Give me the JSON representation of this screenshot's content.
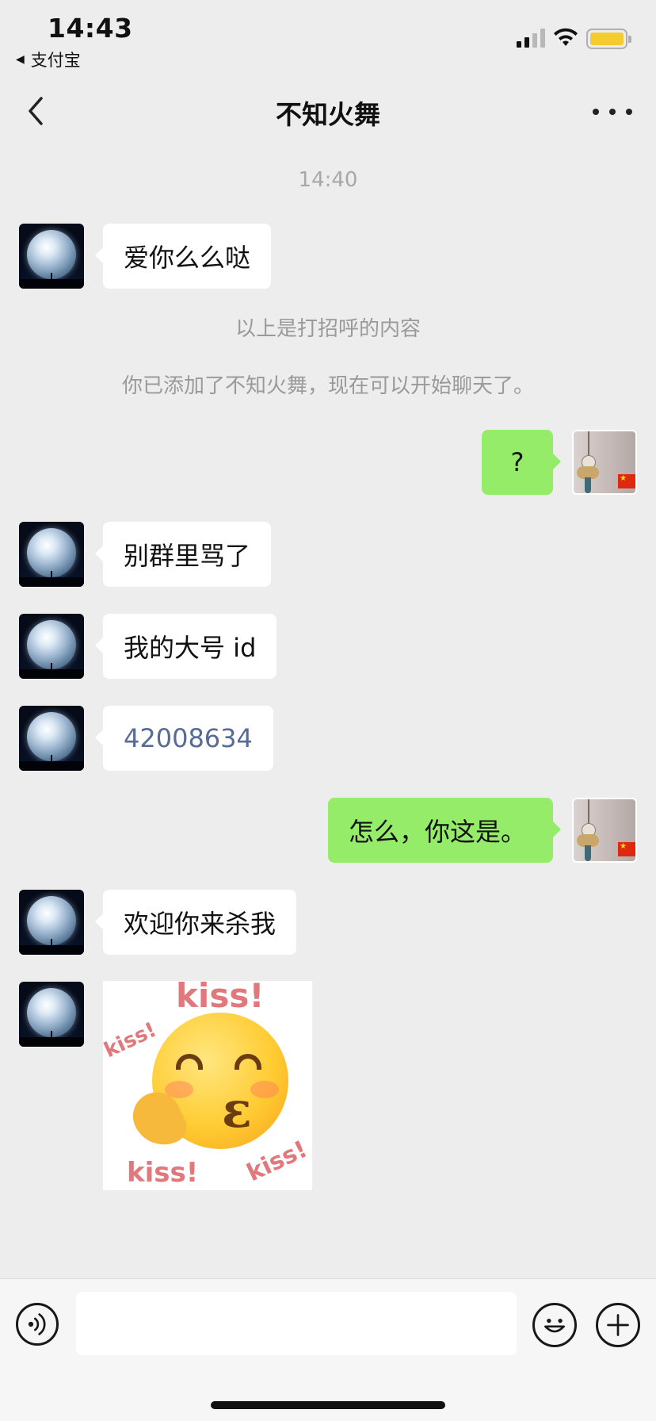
{
  "status_bar": {
    "time": "14:43",
    "back_app": "支付宝",
    "back_icon": "triangle-left",
    "battery_color": "#f5cc2f"
  },
  "nav": {
    "title": "不知火舞",
    "back_icon": "chevron-left-icon",
    "more_icon": "ellipsis-icon"
  },
  "chat": {
    "timestamp": "14:40",
    "system_messages": [
      "以上是打招呼的内容",
      "你已添加了不知火舞，现在可以开始聊天了。"
    ],
    "messages": [
      {
        "side": "left",
        "text": "爱你么么哒"
      },
      {
        "side": "right",
        "text": "?"
      },
      {
        "side": "left",
        "text": "别群里骂了"
      },
      {
        "side": "left",
        "text": "我的大号 id"
      },
      {
        "side": "left",
        "text": "42008634"
      },
      {
        "side": "right",
        "text": "怎么，你这是。"
      },
      {
        "side": "left",
        "text": "欢迎你来杀我"
      },
      {
        "side": "left",
        "type": "sticker",
        "texts": [
          "kiss!",
          "kiss!",
          "kiss!",
          "kiss!"
        ]
      }
    ]
  },
  "colors": {
    "background": "#ededed",
    "bubble_right": "#95ec69",
    "bubble_left": "#ffffff",
    "number_link": "#576b95"
  },
  "input_bar": {
    "voice_icon": "voice-icon",
    "emoji_icon": "emoji-icon",
    "plus_icon": "plus-icon",
    "input_value": ""
  }
}
